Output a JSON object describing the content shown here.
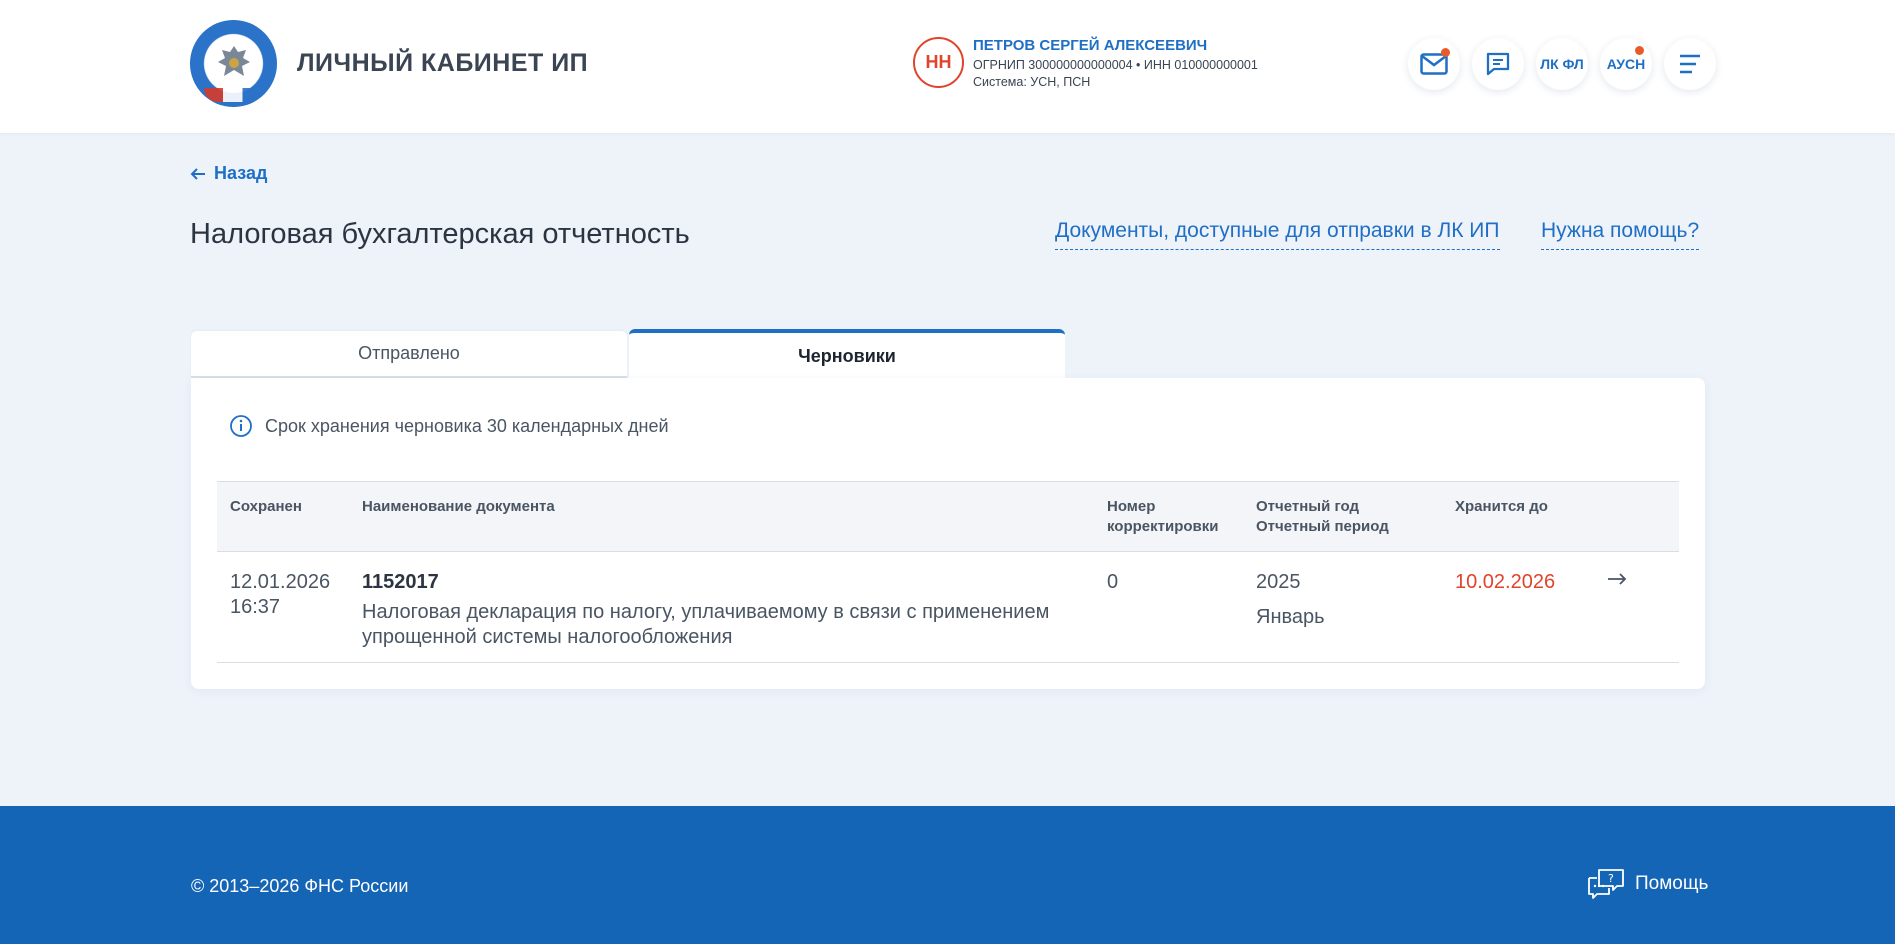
{
  "header": {
    "title": "ЛИЧНЫЙ КАБИНЕТ ИП",
    "user": {
      "initials": "НН",
      "name": "ПЕТРОВ СЕРГЕЙ АЛЕКСЕЕВИЧ",
      "ids": "ОГРНИП 300000000000004 • ИНН 010000000001",
      "system": "Система: УСН, ПСН"
    },
    "buttons": {
      "mail_icon": "mail-icon",
      "chat_icon": "chat-icon",
      "lkfl": "ЛК ФЛ",
      "ausn": "АУСН",
      "menu_icon": "menu-icon"
    },
    "accent": "#1f6fc5",
    "notification_color": "#e85a2a"
  },
  "nav": {
    "back": "Назад"
  },
  "page": {
    "title": "Налоговая бухгалтерская отчетность",
    "link_docs": "Документы, доступные для отправки в ЛК ИП",
    "link_help": "Нужна помощь?"
  },
  "tabs": [
    {
      "label": "Отправлено",
      "active": false
    },
    {
      "label": "Черновики",
      "active": true
    }
  ],
  "notice": "Срок хранения черновика 30 календарных дней",
  "table": {
    "headers": {
      "saved": "Сохранен",
      "name": "Наименование документа",
      "corr_1": "Номер",
      "corr_2": "корректировки",
      "year_1": "Отчетный год",
      "year_2": "Отчетный период",
      "until": "Хранится до"
    },
    "rows": [
      {
        "date": "12.01.2026",
        "time": "16:37",
        "code": "1152017",
        "desc_1": "Налоговая декларация по налогу, уплачиваемому в связи с применением",
        "desc_2": "упрощенной системы налогообложения",
        "correction": "0",
        "year": "2025",
        "period": "Январь",
        "until": "10.02.2026"
      }
    ]
  },
  "footer": {
    "copyright": "© 2013–2026 ФНС России",
    "help": "Помощь"
  }
}
